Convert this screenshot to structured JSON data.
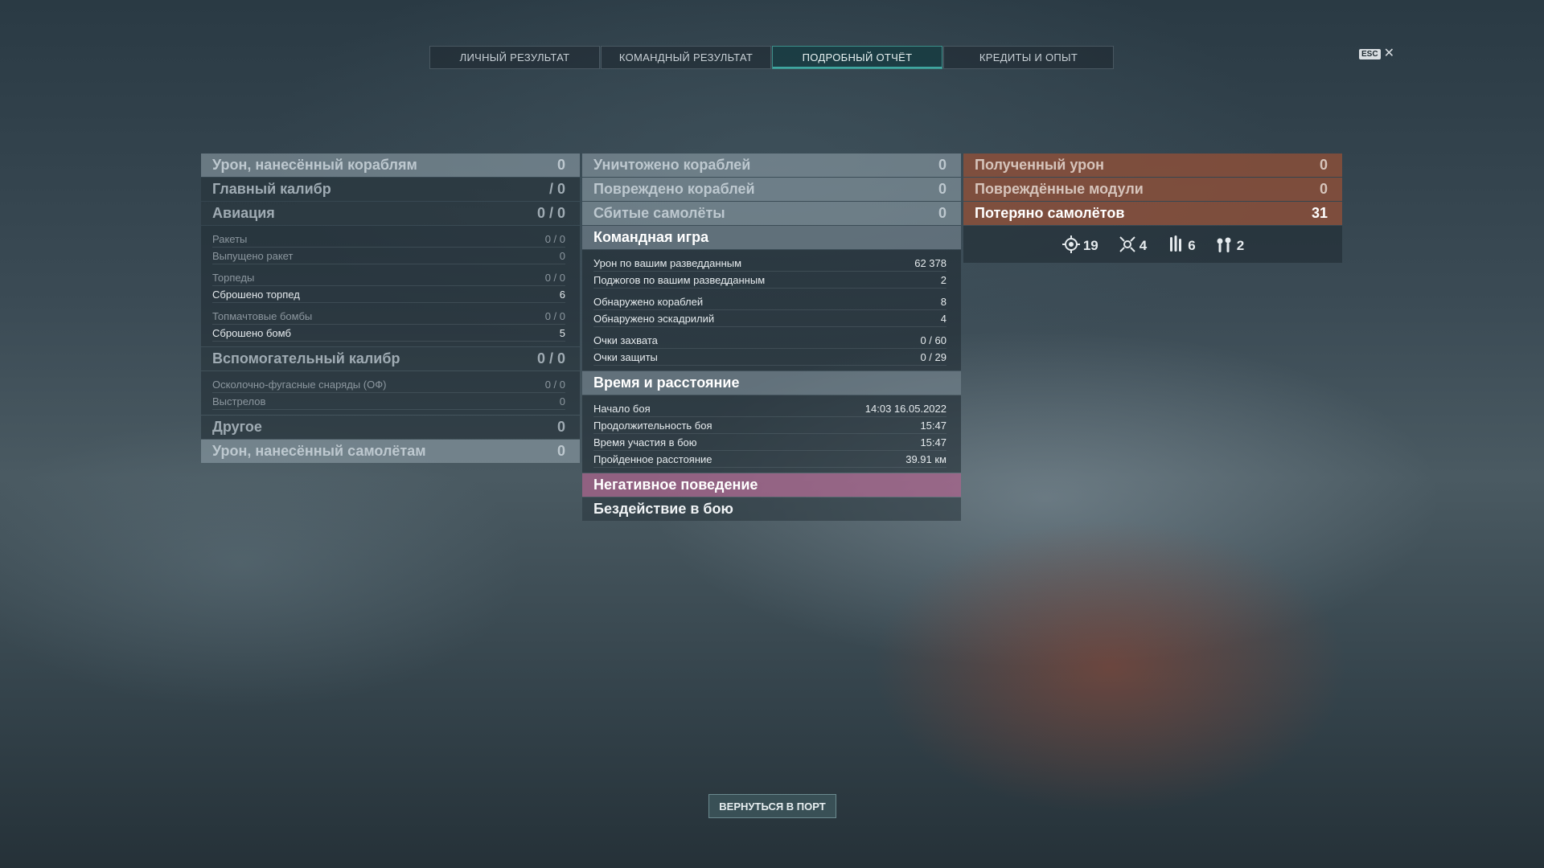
{
  "tabs": [
    "ЛИЧНЫЙ РЕЗУЛЬТАТ",
    "КОМАНДНЫЙ РЕЗУЛЬТАТ",
    "ПОДРОБНЫЙ ОТЧЁТ",
    "КРЕДИТЫ И ОПЫТ"
  ],
  "esc": {
    "key": "ESC",
    "close": "✕"
  },
  "left": {
    "h1": {
      "label": "Урон, нанесённый кораблям",
      "value": "0"
    },
    "h2": {
      "label": "Главный калибр",
      "value": "/ 0"
    },
    "h3": {
      "label": "Авиация",
      "value": "0 / 0"
    },
    "rows1": [
      {
        "label": "Ракеты",
        "value": "0 / 0"
      },
      {
        "label": "Выпущено ракет",
        "value": "0"
      },
      {
        "label": "Торпеды",
        "value": "0 / 0"
      },
      {
        "label": "Сброшено торпед",
        "value": "6"
      },
      {
        "label": "Топмачтовые бомбы",
        "value": "0 / 0"
      },
      {
        "label": "Сброшено бомб",
        "value": "5"
      }
    ],
    "h4": {
      "label": "Вспомогательный калибр",
      "value": "0 / 0"
    },
    "rows2": [
      {
        "label": "Осколочно-фугасные снаряды (ОФ)",
        "value": "0 / 0"
      },
      {
        "label": "Выстрелов",
        "value": "0"
      }
    ],
    "h5": {
      "label": "Другое",
      "value": "0"
    },
    "h6": {
      "label": "Урон, нанесённый самолётам",
      "value": "0"
    }
  },
  "mid": {
    "h1": {
      "label": "Уничтожено кораблей",
      "value": "0"
    },
    "h2": {
      "label": "Повреждено кораблей",
      "value": "0"
    },
    "h3": {
      "label": "Сбитые самолёты",
      "value": "0"
    },
    "team": "Командная игра",
    "team_rows": [
      {
        "label": "Урон по вашим разведданным",
        "value": "62 378"
      },
      {
        "label": "Поджогов по вашим разведданным",
        "value": "2"
      },
      {
        "label": "Обнаружено кораблей",
        "value": "8"
      },
      {
        "label": "Обнаружено эскадрилий",
        "value": "4"
      },
      {
        "label": "Очки захвата",
        "value": "0 / 60"
      },
      {
        "label": "Очки защиты",
        "value": "0 / 29"
      }
    ],
    "time": "Время и расстояние",
    "time_rows": [
      {
        "label": "Начало боя",
        "value": "14:03  16.05.2022"
      },
      {
        "label": "Продолжительность боя",
        "value": "15:47"
      },
      {
        "label": "Время участия в бою",
        "value": "15:47"
      },
      {
        "label": "Пройденное расстояние",
        "value": "39.91 км"
      }
    ],
    "neg": "Негативное поведение",
    "neg_item": "Бездействие в бою"
  },
  "right": {
    "h1": {
      "label": "Полученный урон",
      "value": "0"
    },
    "h2": {
      "label": "Повреждённые модули",
      "value": "0"
    },
    "h3": {
      "label": "Потеряно самолётов",
      "value": "31"
    },
    "icons": [
      {
        "name": "crosshair-icon",
        "value": "19"
      },
      {
        "name": "plane-destroyed-icon",
        "value": "4"
      },
      {
        "name": "torpedo-icon",
        "value": "6"
      },
      {
        "name": "bomb-icon",
        "value": "2"
      }
    ]
  },
  "button": "ВЕРНУТЬСЯ В ПОРТ"
}
